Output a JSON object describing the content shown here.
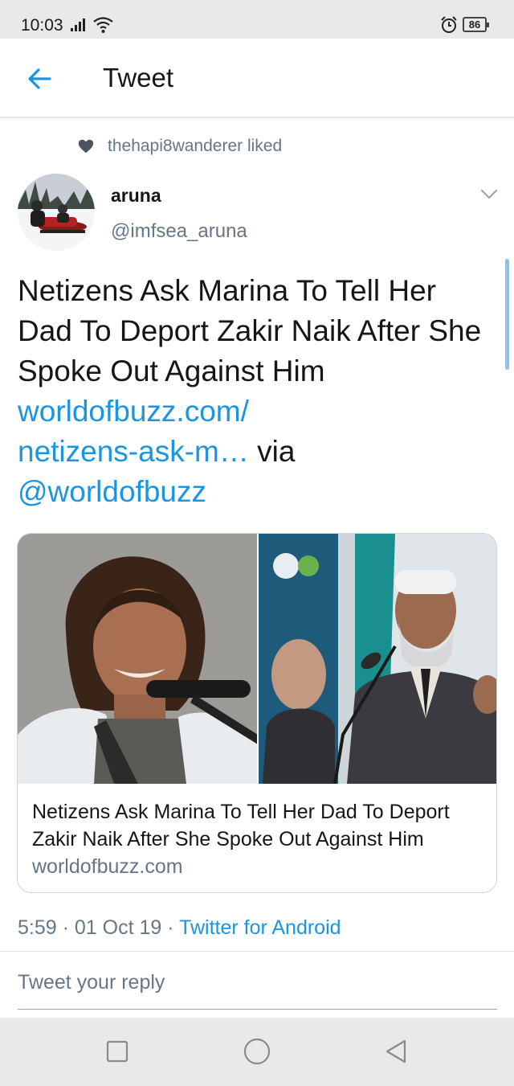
{
  "status_bar": {
    "time": "10:03",
    "battery": "86",
    "icons": [
      "signal-icon",
      "wifi-icon",
      "alarm-icon",
      "battery-icon"
    ]
  },
  "header": {
    "back_icon": "arrow-left-icon",
    "title": "Tweet"
  },
  "social_context": {
    "icon": "heart-icon",
    "text": "thehapi8wanderer liked"
  },
  "author": {
    "name": "aruna",
    "handle": "@imfsea_aruna",
    "menu_icon": "chevron-down-icon"
  },
  "tweet": {
    "text_plain": "Netizens Ask Marina To Tell Her Dad To Deport Zakir Naik After She Spoke Out Against Him ",
    "link_line1": "worldofbuzz.com/",
    "link_line2": "netizens-ask-m…",
    "via_text": " via ",
    "mention": "@worldofbuzz"
  },
  "card": {
    "title": "Netizens Ask Marina To Tell Her Dad To Deport Zakir Naik After She Spoke Out Against Him",
    "domain": "worldofbuzz.com"
  },
  "meta": {
    "time": "5:59",
    "separator": " · ",
    "date": "01 Oct 19",
    "source": "Twitter for Android"
  },
  "reply": {
    "placeholder": "Tweet your reply"
  },
  "nav": {
    "buttons": [
      "recent-apps-icon",
      "home-icon",
      "back-triangle-icon"
    ]
  },
  "colors": {
    "accent": "#1b95e0",
    "secondary_text": "#657786",
    "primary_text": "#14171a",
    "bars": "#e9e9ec"
  }
}
